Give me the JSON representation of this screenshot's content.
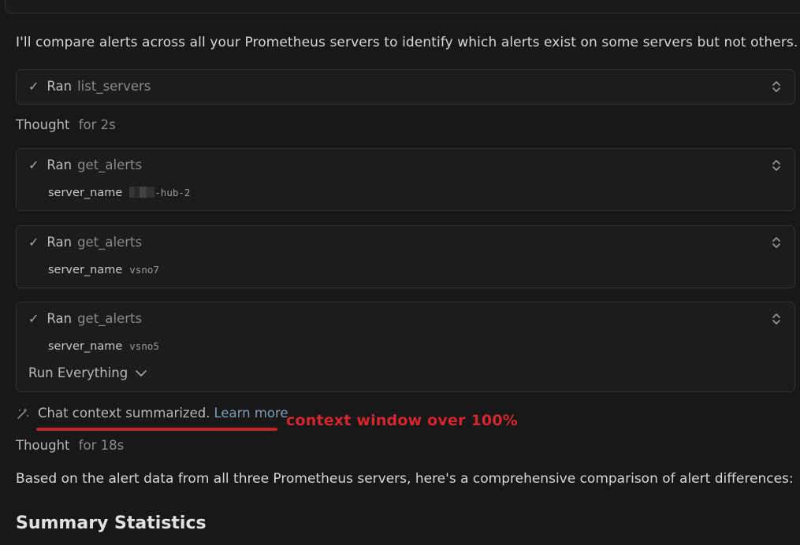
{
  "intro_text": "I'll compare alerts across all your Prometheus servers to identify which alerts exist on some servers but not others.",
  "tool_calls": [
    {
      "status": "Ran",
      "tool": "list_servers"
    },
    {
      "status": "Ran",
      "tool": "get_alerts",
      "param_key": "server_name",
      "param_value": "-hub-2",
      "param_redacted": true
    },
    {
      "status": "Ran",
      "tool": "get_alerts",
      "param_key": "server_name",
      "param_value": "vsno7"
    },
    {
      "status": "Ran",
      "tool": "get_alerts",
      "param_key": "server_name",
      "param_value": "vsno5",
      "run_everything_label": "Run Everything"
    }
  ],
  "thoughts": [
    {
      "label": "Thought",
      "duration": "for 2s"
    },
    {
      "label": "Thought",
      "duration": "for 18s"
    }
  ],
  "summarized": {
    "text": "Chat context summarized.",
    "link": "Learn more"
  },
  "annotation": {
    "text": "context window over 100%",
    "color": "#d3262e"
  },
  "response_text": "Based on the alert data from all three Prometheus servers, here's a comprehensive comparison of alert differences:",
  "section_heading": "Summary Statistics",
  "icons": {
    "check": "check-icon",
    "expand": "chevron-updown-icon",
    "dropdown": "chevron-down-icon",
    "summarize": "magic-wand-icon"
  }
}
